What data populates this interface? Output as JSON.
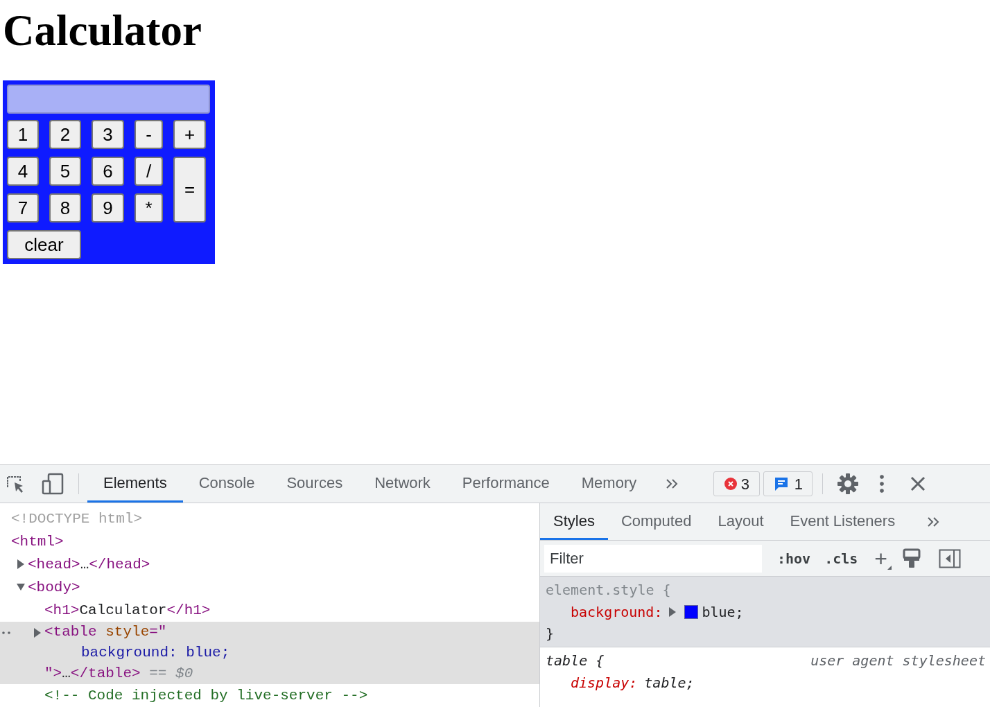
{
  "page": {
    "heading": "Calculator",
    "calculator": {
      "keys": [
        {
          "label": "1",
          "kind": "key"
        },
        {
          "label": "2",
          "kind": "key"
        },
        {
          "label": "3",
          "kind": "key"
        },
        {
          "label": "-",
          "kind": "key"
        },
        {
          "label": "+",
          "kind": "key"
        },
        {
          "label": "4",
          "kind": "key"
        },
        {
          "label": "5",
          "kind": "key"
        },
        {
          "label": "6",
          "kind": "key"
        },
        {
          "label": "/",
          "kind": "key"
        },
        {
          "label": "=",
          "kind": "tall"
        },
        {
          "label": "7",
          "kind": "key"
        },
        {
          "label": "8",
          "kind": "key"
        },
        {
          "label": "9",
          "kind": "key"
        },
        {
          "label": "*",
          "kind": "key"
        },
        {
          "label": "clear",
          "kind": "wide"
        }
      ]
    }
  },
  "devtools": {
    "tabs": [
      {
        "label": "Elements",
        "selected": true
      },
      {
        "label": "Console",
        "selected": false
      },
      {
        "label": "Sources",
        "selected": false
      },
      {
        "label": "Network",
        "selected": false
      },
      {
        "label": "Performance",
        "selected": false
      },
      {
        "label": "Memory",
        "selected": false
      }
    ],
    "error_count": "3",
    "message_count": "1",
    "dom_tree": [
      {
        "lines": [
          [
            {
              "kind": "doctype",
              "text": "<!DOCTYPE html>"
            }
          ]
        ],
        "selected": false
      },
      {
        "lines": [
          [
            {
              "kind": "tag",
              "text": "<html>"
            }
          ]
        ],
        "selected": false,
        "children": [
          {
            "lines": [
              [
                {
                  "kind": "tag",
                  "text": "<head>"
                },
                {
                  "kind": "text",
                  "text": "…"
                },
                {
                  "kind": "tag",
                  "text": "</head>"
                }
              ]
            ],
            "selected": false,
            "expanded": false
          },
          {
            "lines": [
              [
                {
                  "kind": "tag",
                  "text": "<body>"
                }
              ]
            ],
            "selected": false,
            "expanded": true,
            "children": [
              {
                "lines": [
                  [
                    {
                      "kind": "tag",
                      "text": "<h1>"
                    },
                    {
                      "kind": "text",
                      "text": "Calculator"
                    },
                    {
                      "kind": "tag",
                      "text": "</h1>"
                    }
                  ]
                ],
                "selected": false
              },
              {
                "lines": [
                  [
                    {
                      "kind": "tag",
                      "text": "<table "
                    },
                    {
                      "kind": "attr",
                      "text": "style"
                    },
                    {
                      "kind": "tag",
                      "text": "=\""
                    }
                  ],
                  [
                    {
                      "kind": "value",
                      "text": "background: blue;"
                    }
                  ],
                  [
                    {
                      "kind": "tag",
                      "text": "\">"
                    },
                    {
                      "kind": "text",
                      "text": "…"
                    },
                    {
                      "kind": "tag",
                      "text": "</table>"
                    },
                    {
                      "kind": "hint",
                      "text": " == "
                    },
                    {
                      "kind": "var",
                      "text": "$0"
                    }
                  ]
                ],
                "selected": true,
                "expanded": false
              },
              {
                "lines": [
                  [
                    {
                      "kind": "comment",
                      "text": "<!-- Code injected by live-server -->"
                    }
                  ]
                ],
                "selected": false
              }
            ]
          }
        ]
      }
    ],
    "side_tabs": [
      {
        "label": "Styles",
        "selected": true
      },
      {
        "label": "Computed",
        "selected": false
      },
      {
        "label": "Layout",
        "selected": false
      },
      {
        "label": "Event Listeners",
        "selected": false
      }
    ],
    "filter": {
      "placeholder": "Filter"
    },
    "hov": ":hov",
    "cls": ".cls",
    "add": "+",
    "rules": [
      {
        "kind": "inline",
        "selector": "element.style {",
        "props": [
          {
            "name": "background:",
            "value": "blue;",
            "color": "#0000ff"
          }
        ],
        "close": "}"
      },
      {
        "kind": "user_agent",
        "selector": "table {",
        "source": "user agent stylesheet",
        "props": [
          {
            "name": "display:",
            "value": "table;"
          }
        ]
      }
    ]
  }
}
